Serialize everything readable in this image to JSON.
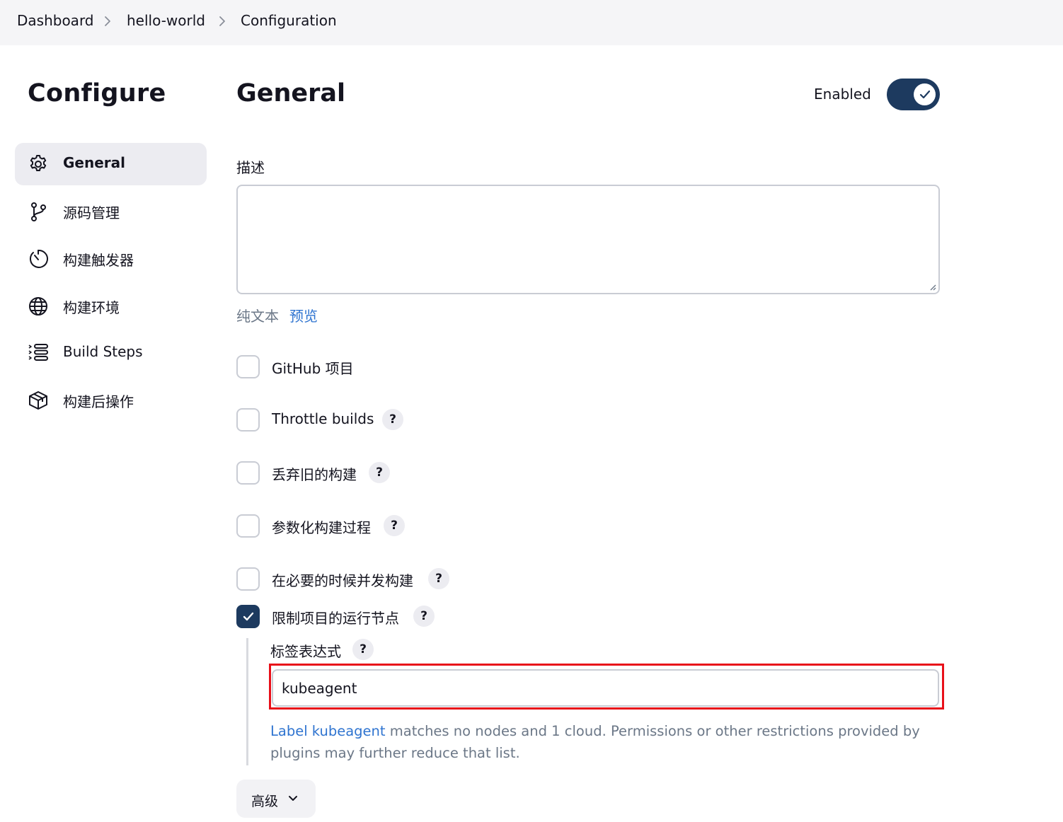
{
  "breadcrumb": {
    "items": [
      "Dashboard",
      "hello-world",
      "Configuration"
    ]
  },
  "sidebar": {
    "title": "Configure",
    "items": [
      {
        "label": "General",
        "icon": "gear-icon",
        "active": true
      },
      {
        "label": "源码管理",
        "icon": "git-branch-icon",
        "active": false
      },
      {
        "label": "构建触发器",
        "icon": "timer-icon",
        "active": false
      },
      {
        "label": "构建环境",
        "icon": "globe-icon",
        "active": false
      },
      {
        "label": "Build Steps",
        "icon": "list-steps-icon",
        "active": false
      },
      {
        "label": "构建后操作",
        "icon": "package-icon",
        "active": false
      }
    ]
  },
  "main": {
    "title": "General",
    "enabled_label": "Enabled",
    "enabled": true,
    "description": {
      "label": "描述",
      "value": "",
      "plain_text_label": "纯文本",
      "preview_label": "预览"
    },
    "options": [
      {
        "label": "GitHub 项目",
        "checked": false,
        "help": false
      },
      {
        "label": "Throttle builds",
        "checked": false,
        "help": true
      },
      {
        "label": "丢弃旧的构建",
        "checked": false,
        "help": true
      },
      {
        "label": "参数化构建过程",
        "checked": false,
        "help": true
      },
      {
        "label": "在必要的时候并发构建",
        "checked": false,
        "help": true
      },
      {
        "label": "限制项目的运行节点",
        "checked": true,
        "help": true
      }
    ],
    "label_expression": {
      "label": "标签表达式",
      "help": "?",
      "value": "kubeagent",
      "info_link": "Label kubeagent",
      "info_text_1": " matches no nodes and 1 cloud. Permissions or other restrictions provided by",
      "info_text_2": "plugins may further reduce that list."
    },
    "advanced_label": "高级",
    "help_glyph": "?"
  },
  "colors": {
    "accent": "#1d3a5f",
    "link": "#2f74d0",
    "highlight": "#e8101a",
    "muted_text": "#6b7787"
  }
}
